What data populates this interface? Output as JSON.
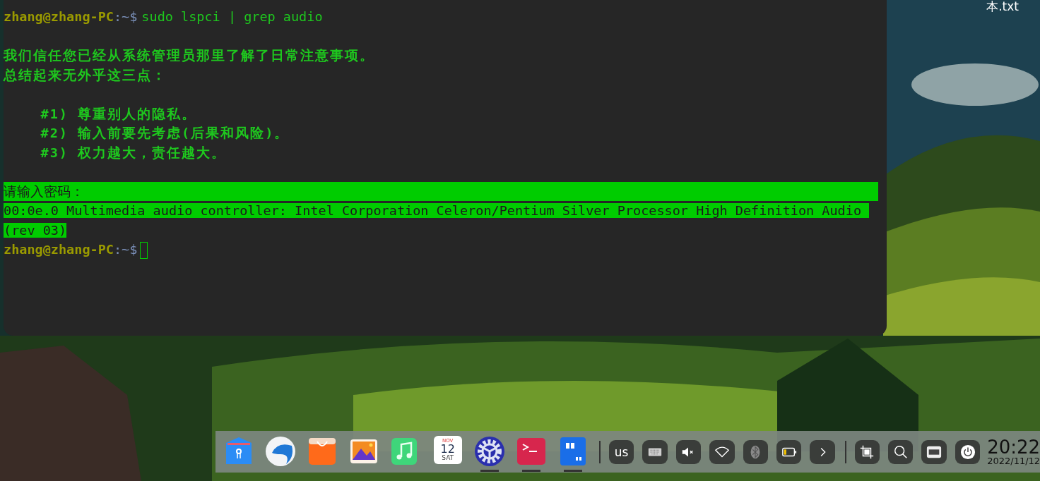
{
  "desktop": {
    "files": [
      {
        "label": "本.txt"
      }
    ]
  },
  "terminal": {
    "lines": [
      {
        "kind": "prompt",
        "user": "zhang@zhang-PC",
        "path": ":~$",
        "command": "sudo lspci | grep audio"
      },
      {
        "kind": "blank"
      },
      {
        "kind": "text",
        "text": "我们信任您已经从系统管理员那里了解了日常注意事项。"
      },
      {
        "kind": "text",
        "text": "总结起来无外乎这三点："
      },
      {
        "kind": "blank"
      },
      {
        "kind": "text",
        "text": "    #1) 尊重别人的隐私。"
      },
      {
        "kind": "text",
        "text": "    #2) 输入前要先考虑(后果和风险)。"
      },
      {
        "kind": "text",
        "text": "    #3) 权力越大，责任越大。"
      },
      {
        "kind": "blank"
      },
      {
        "kind": "selected",
        "text": "请输入密码："
      },
      {
        "kind": "selected",
        "text": "00:0e.0 Multimedia audio controller: Intel Corporation Celeron/Pentium Silver Processor High Definition Audio (rev 03)"
      },
      {
        "kind": "prompt",
        "user": "zhang@zhang-PC",
        "path": ":~$",
        "cursor": true
      }
    ]
  },
  "dock": {
    "apps": [
      {
        "kind": "files",
        "running": false
      },
      {
        "kind": "browser",
        "running": false
      },
      {
        "kind": "store",
        "running": false
      },
      {
        "kind": "photos",
        "running": false
      },
      {
        "kind": "music",
        "running": false
      },
      {
        "kind": "calendar",
        "running": false,
        "month": "NOV",
        "day": "12",
        "weekday": "SAT"
      },
      {
        "kind": "settings",
        "running": true
      },
      {
        "kind": "terminal",
        "running": true
      },
      {
        "kind": "notes",
        "running": true
      }
    ],
    "tray": [
      {
        "kind": "text",
        "text": "us"
      },
      {
        "kind": "keyboard"
      },
      {
        "kind": "mute"
      },
      {
        "kind": "wifi"
      },
      {
        "kind": "bluetooth"
      },
      {
        "kind": "battery",
        "level": 0.25
      },
      {
        "kind": "expand"
      }
    ],
    "tools": [
      {
        "kind": "crop"
      },
      {
        "kind": "search"
      },
      {
        "kind": "keyboard"
      },
      {
        "kind": "power"
      }
    ],
    "clock": {
      "time": "20:22",
      "date": "2022/11/12"
    }
  }
}
